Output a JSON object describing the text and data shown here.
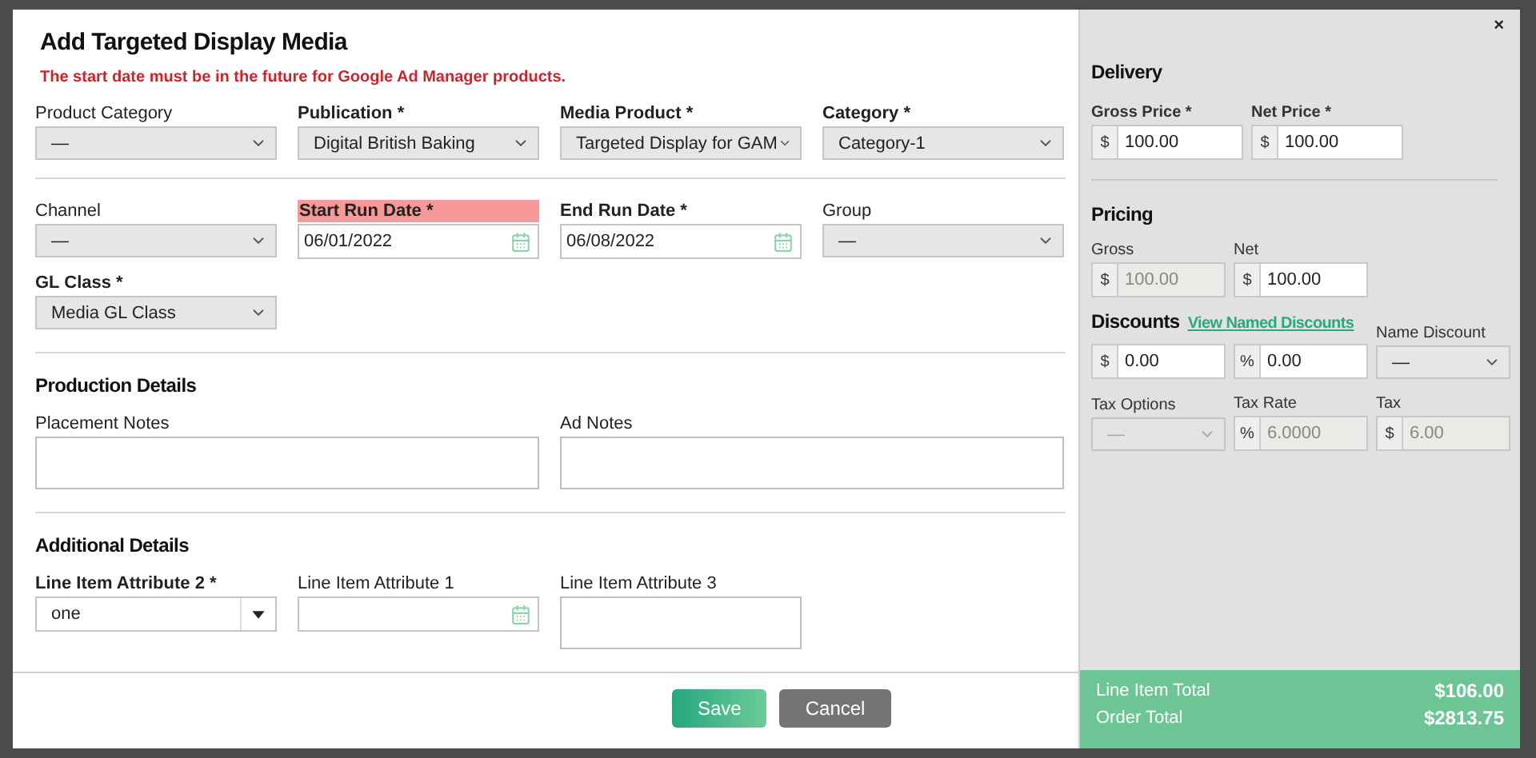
{
  "dialog": {
    "title": "Add Targeted Display Media",
    "error": "The start date must be in the future for Google Ad Manager products.",
    "close": "×"
  },
  "groups": [
    {
      "rows": [
        [
          {
            "kind": "select",
            "label": "Product Category",
            "required": false,
            "value": "—"
          },
          {
            "kind": "select",
            "label": "Publication *",
            "required": true,
            "value": "Digital British Baking"
          },
          {
            "kind": "select",
            "label": "Media Product *",
            "required": true,
            "value": "Targeted Display for GAM"
          },
          {
            "kind": "select",
            "label": "Category *",
            "required": true,
            "value": "Category-1"
          }
        ]
      ]
    },
    {
      "rows": [
        [
          {
            "kind": "select",
            "label": "Channel",
            "required": false,
            "value": "—"
          },
          {
            "kind": "date",
            "label": "Start Run Date *",
            "required": true,
            "invalid": true,
            "value": "06/01/2022"
          },
          {
            "kind": "date",
            "label": "End Run Date *",
            "required": true,
            "invalid": false,
            "value": "06/08/2022"
          },
          {
            "kind": "select",
            "label": "Group",
            "required": false,
            "value": "—"
          }
        ],
        [
          {
            "kind": "select",
            "label": "GL Class *",
            "required": true,
            "value": "Media GL Class"
          }
        ]
      ]
    },
    {
      "heading": "Production Details",
      "rows": [
        [
          {
            "kind": "textarea",
            "label": "Placement Notes",
            "required": false,
            "wide": true
          },
          {
            "kind": "textarea",
            "label": "Ad Notes",
            "required": false,
            "wide": true
          }
        ]
      ]
    },
    {
      "heading": "Additional Details",
      "rows": [
        [
          {
            "kind": "combo",
            "label": "Line Item Attribute 2 *",
            "required": true,
            "value": "one"
          },
          {
            "kind": "date",
            "label": "Line Item Attribute 1",
            "required": false,
            "invalid": false
          },
          {
            "kind": "textarea",
            "label": "Line Item Attribute 3",
            "required": false,
            "wide": false
          }
        ]
      ]
    }
  ],
  "buttons": [
    {
      "label": "Save",
      "kind": "primary"
    },
    {
      "label": "Cancel",
      "kind": "secondary"
    }
  ],
  "side": {
    "delivery": {
      "title": "Delivery",
      "fields": [
        {
          "label": "Gross Price *",
          "prefix": "$",
          "value": "100.00",
          "disabled": false
        },
        {
          "label": "Net Price *",
          "prefix": "$",
          "value": "100.00",
          "disabled": false
        }
      ]
    },
    "pricing": {
      "title": "Pricing",
      "fields": [
        {
          "kind": "money",
          "label": "Gross",
          "prefix": "$",
          "value": "100.00",
          "disabled": true
        },
        {
          "kind": "money",
          "label": "Net",
          "prefix": "$",
          "value": "100.00",
          "disabled": false
        }
      ]
    },
    "discounts": {
      "title": "Discounts",
      "link": "View Named Discounts",
      "fields": [
        {
          "kind": "money",
          "prefix": "$",
          "value": "0.00",
          "disabled": false
        },
        {
          "kind": "money",
          "prefix": "%",
          "value": "0.00",
          "disabled": false
        },
        {
          "kind": "select",
          "label": "Name Discount",
          "value": "—",
          "disabled": false
        }
      ]
    },
    "tax": [
      {
        "kind": "select",
        "label": "Tax Options",
        "value": "—",
        "disabled": true
      },
      {
        "kind": "money",
        "label": "Tax Rate",
        "prefix": "%",
        "value": "6.0000",
        "disabled": true
      },
      {
        "kind": "money",
        "label": "Tax",
        "prefix": "$",
        "value": "6.00",
        "disabled": true
      }
    ]
  },
  "totals": [
    {
      "label": "Line Item Total",
      "value": "$106.00"
    },
    {
      "label": "Order Total",
      "value": "$2813.75"
    }
  ]
}
